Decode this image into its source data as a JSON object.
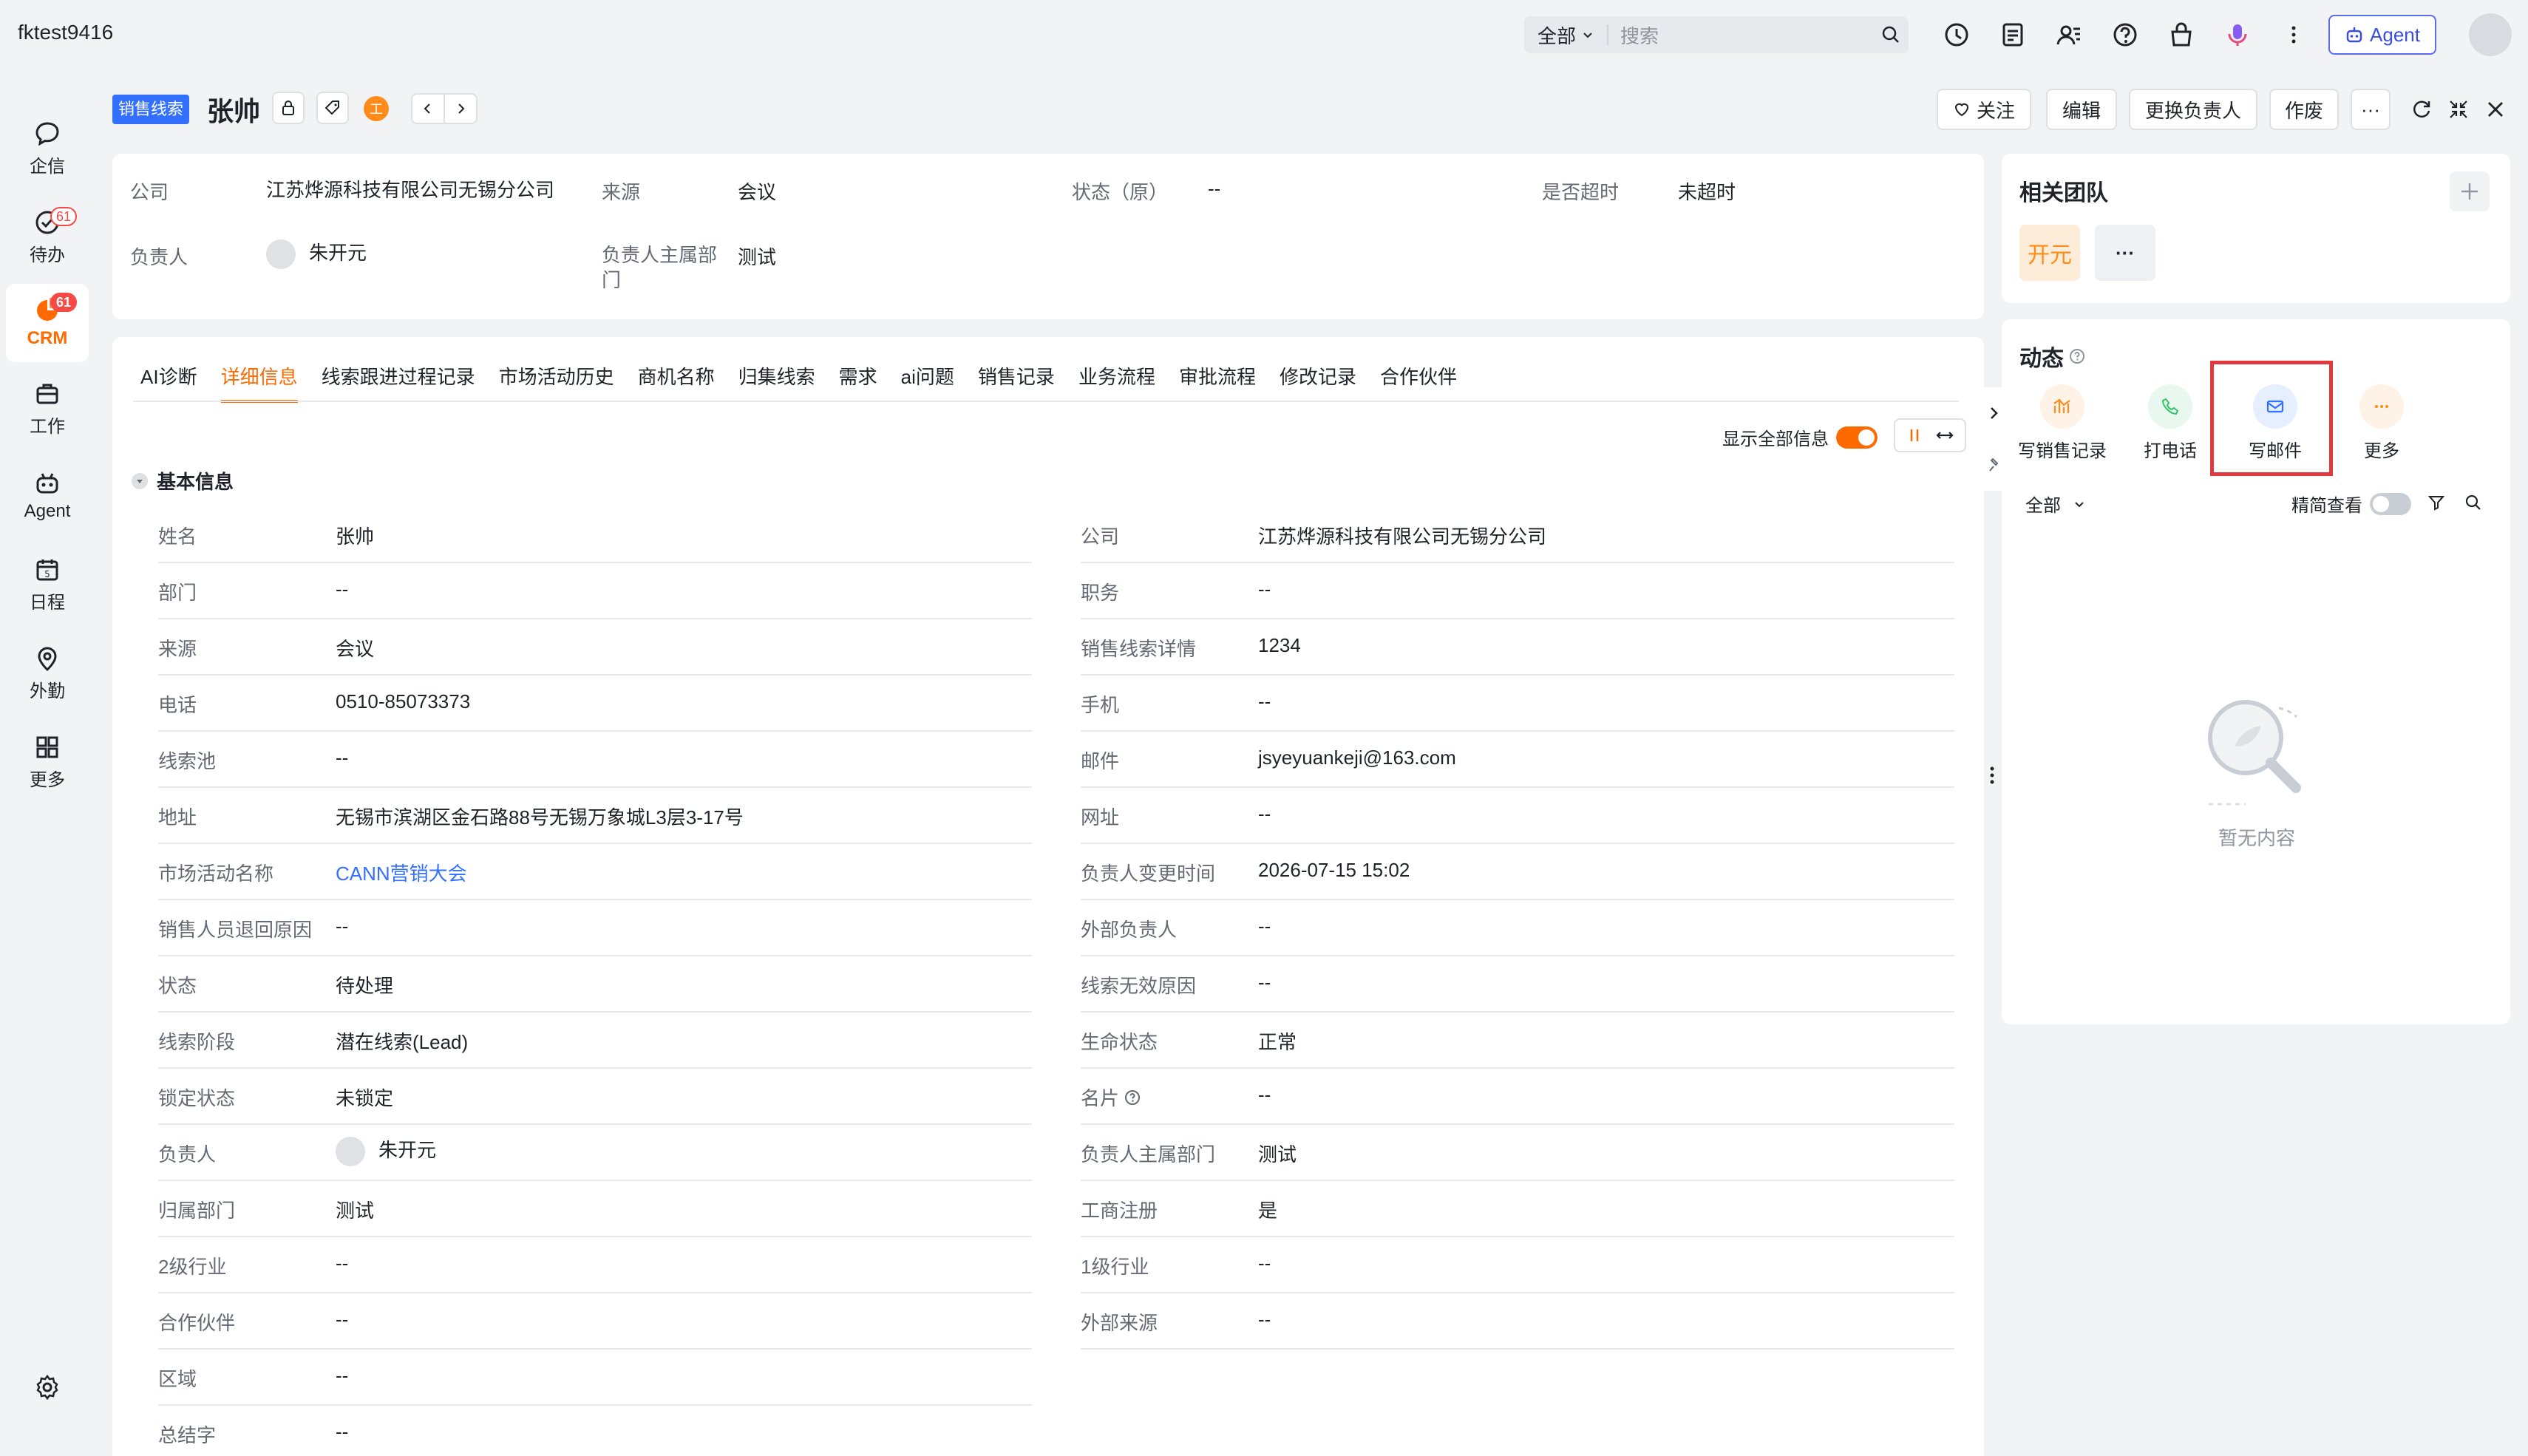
{
  "topbar": {
    "tenant": "fktest9416",
    "search_scope": "全部",
    "search_placeholder": "搜索",
    "agent_label": "Agent"
  },
  "leftnav": [
    {
      "label": "企信",
      "icon": "chat-icon",
      "badge": ""
    },
    {
      "label": "待办",
      "icon": "todo-check-icon",
      "badge": "61"
    },
    {
      "label": "CRM",
      "icon": "crm-pie-icon",
      "badge": "61",
      "active": true
    },
    {
      "label": "工作",
      "icon": "briefcase-icon",
      "badge": ""
    },
    {
      "label": "Agent",
      "icon": "robot-icon",
      "badge": ""
    },
    {
      "label": "日程",
      "icon": "calendar-icon",
      "badge": ""
    },
    {
      "label": "外勤",
      "icon": "location-pin-icon",
      "badge": ""
    },
    {
      "label": "更多",
      "icon": "grid-icon",
      "badge": ""
    }
  ],
  "header": {
    "type_tag": "销售线索",
    "title": "张帅",
    "badge_letter": "工",
    "buttons": {
      "follow": "关注",
      "edit": "编辑",
      "change_owner": "更换负责人",
      "void": "作废",
      "more": "···"
    }
  },
  "summary": {
    "company_label": "公司",
    "company_value": "江苏烨源科技有限公司无锡分公司",
    "source_label": "来源",
    "source_value": "会议",
    "status_label": "状态（原）",
    "status_value": "--",
    "overdue_label": "是否超时",
    "overdue_value": "未超时",
    "owner_label": "负责人",
    "owner_value": "朱开元",
    "owner_dept_label": "负责人主属部门",
    "owner_dept_value": "测试"
  },
  "tabs": [
    "AI诊断",
    "详细信息",
    "线索跟进过程记录",
    "市场活动历史",
    "商机名称",
    "归集线索",
    "需求",
    "ai问题",
    "销售记录",
    "业务流程",
    "审批流程",
    "修改记录",
    "合作伙伴"
  ],
  "active_tab": "详细信息",
  "show_all_label": "显示全部信息",
  "section_title": "基本信息",
  "fields_left": [
    {
      "label": "姓名",
      "value": "张帅"
    },
    {
      "label": "部门",
      "value": "--"
    },
    {
      "label": "来源",
      "value": "会议"
    },
    {
      "label": "电话",
      "value": "0510-85073373"
    },
    {
      "label": "线索池",
      "value": "--"
    },
    {
      "label": "地址",
      "value": "无锡市滨湖区金石路88号无锡万象城L3层3-17号"
    },
    {
      "label": "市场活动名称",
      "value": "CANN营销大会"
    },
    {
      "label": "销售人员退回原因",
      "value": "--"
    },
    {
      "label": "状态",
      "value": "待处理"
    },
    {
      "label": "线索阶段",
      "value": "潜在线索(Lead)"
    },
    {
      "label": "锁定状态",
      "value": "未锁定"
    },
    {
      "label": "负责人",
      "value": "朱开元"
    },
    {
      "label": "归属部门",
      "value": "测试"
    },
    {
      "label": "2级行业",
      "value": "--"
    },
    {
      "label": "合作伙伴",
      "value": "--"
    },
    {
      "label": "区域",
      "value": "--"
    },
    {
      "label": "总结字",
      "value": "--"
    }
  ],
  "fields_right": [
    {
      "label": "公司",
      "value": "江苏烨源科技有限公司无锡分公司"
    },
    {
      "label": "职务",
      "value": "--"
    },
    {
      "label": "销售线索详情",
      "value": "1234"
    },
    {
      "label": "手机",
      "value": "--"
    },
    {
      "label": "邮件",
      "value": "jsyeyuankeji@163.com"
    },
    {
      "label": "网址",
      "value": "--"
    },
    {
      "label": "负责人变更时间",
      "value": "2026-07-15 15:02"
    },
    {
      "label": "外部负责人",
      "value": "--"
    },
    {
      "label": "线索无效原因",
      "value": "--"
    },
    {
      "label": "生命状态",
      "value": "正常"
    },
    {
      "label": "名片",
      "value": "--"
    },
    {
      "label": "负责人主属部门",
      "value": "测试"
    },
    {
      "label": "工商注册",
      "value": "是"
    },
    {
      "label": "1级行业",
      "value": "--"
    },
    {
      "label": "外部来源",
      "value": "--"
    }
  ],
  "right_panel": {
    "team_title": "相关团队",
    "team_member": "开元",
    "team_more": "···",
    "activity_title": "动态",
    "actions": [
      {
        "label": "写销售记录",
        "icon": "sales-record-icon",
        "color": "#ff8c1a"
      },
      {
        "label": "打电话",
        "icon": "phone-icon",
        "color": "#34c36b"
      },
      {
        "label": "写邮件",
        "icon": "mail-icon",
        "color": "#3370ff"
      },
      {
        "label": "更多",
        "icon": "more-dots-icon",
        "color": "#ff8c1a"
      }
    ],
    "filter_label": "全部",
    "compact_label": "精简查看",
    "empty_text": "暂无内容"
  },
  "colors": {
    "accent": "#ff6a00",
    "link": "#3370ff",
    "highlight": "#e0393e"
  }
}
